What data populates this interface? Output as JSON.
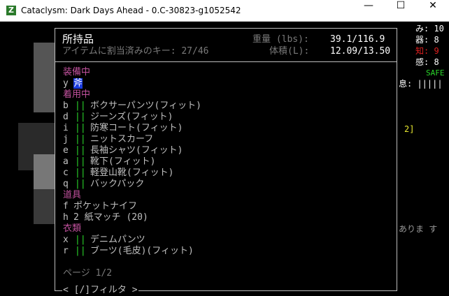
{
  "window": {
    "title": "Cataclysm: Dark Days Ahead - 0.C-30823-g1052542",
    "minimize": "—",
    "maximize": "☐",
    "close": "✕"
  },
  "sidebar": {
    "stat1": "み: 10",
    "stat2": "器: 8",
    "stat3": "知: 9",
    "stat4": "感: 8",
    "safe": "SAFE",
    "breath": "息: |||||",
    "num": "2]",
    "arimasu": "ありま す"
  },
  "panel": {
    "title": "所持品",
    "keys": "アイテムに割当済みのキー: 27/46",
    "weight_label": "重量 (lbs):",
    "weight_value": "39.1/116.9",
    "volume_label": "体積(L):",
    "volume_value": "12.09/13.50",
    "categories": {
      "wielded": "装備中",
      "worn": "着用中",
      "tools": "道具",
      "clothing": "衣類"
    },
    "wielded_item": {
      "letter": "y",
      "name": "斧"
    },
    "worn_items": [
      {
        "letter": "b",
        "name": "ボクサーパンツ(フィット)"
      },
      {
        "letter": "d",
        "name": "ジーンズ(フィット)"
      },
      {
        "letter": "i",
        "name": "防寒コート(フィット)"
      },
      {
        "letter": "j",
        "name": "ニットスカーフ"
      },
      {
        "letter": "e",
        "name": "長袖シャツ(フィット)"
      },
      {
        "letter": "a",
        "name": "靴下(フィット)"
      },
      {
        "letter": "c",
        "name": "軽登山靴(フィット)"
      },
      {
        "letter": "q",
        "name": "バックパック"
      }
    ],
    "tool_items": [
      {
        "letter": "f",
        "name": "ポケットナイフ"
      },
      {
        "letter": "h",
        "name": "2 紙マッチ (20)"
      }
    ],
    "clothing_items": [
      {
        "letter": "x",
        "name": "デニムパンツ"
      },
      {
        "letter": "r",
        "name": "ブーツ(毛皮)(フィット)"
      }
    ],
    "bars": "||",
    "page": "ページ 1/2",
    "filter": "< [/]フィルタ >"
  }
}
